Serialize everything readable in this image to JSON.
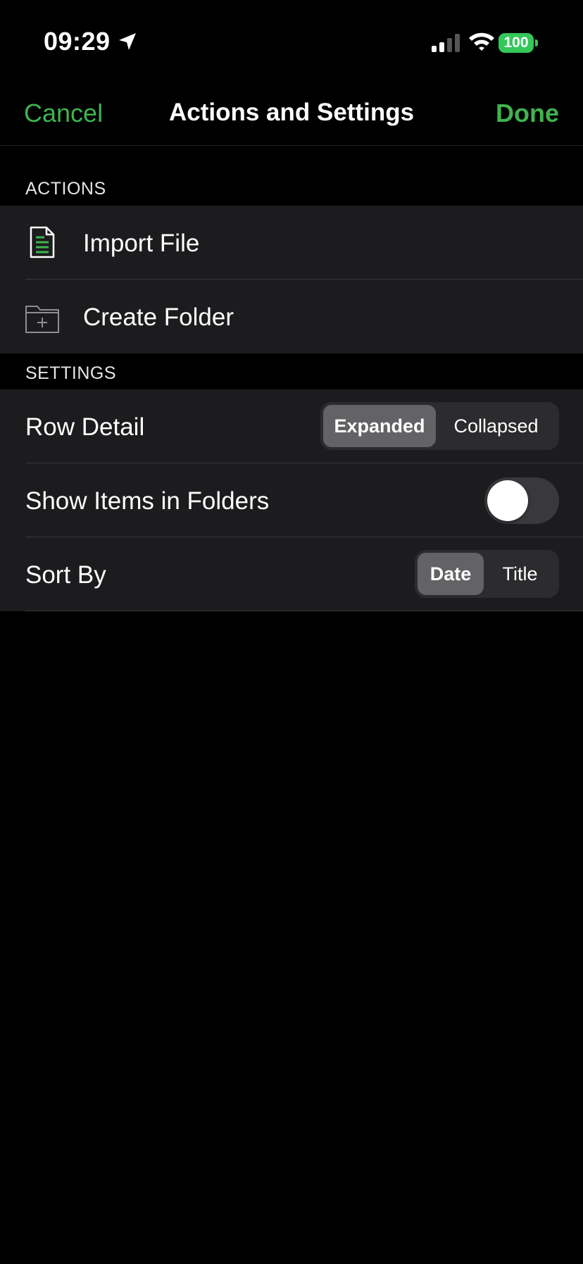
{
  "status_bar": {
    "time": "09:29",
    "battery": "100"
  },
  "nav": {
    "cancel_label": "Cancel",
    "title": "Actions and Settings",
    "done_label": "Done"
  },
  "actions": {
    "header": "ACTIONS",
    "items": [
      {
        "label": "Import File",
        "icon": "document-icon"
      },
      {
        "label": "Create Folder",
        "icon": "folder-add-icon"
      }
    ]
  },
  "settings": {
    "header": "SETTINGS",
    "row_detail": {
      "label": "Row Detail",
      "options": [
        "Expanded",
        "Collapsed"
      ],
      "selected": "Expanded"
    },
    "show_items": {
      "label": "Show Items in Folders",
      "enabled": false
    },
    "sort_by": {
      "label": "Sort By",
      "options": [
        "Date",
        "Title"
      ],
      "selected": "Date"
    }
  },
  "colors": {
    "accent": "#3fb34f",
    "background": "#000000",
    "row_bg": "#1c1c1e",
    "battery": "#34c759"
  }
}
